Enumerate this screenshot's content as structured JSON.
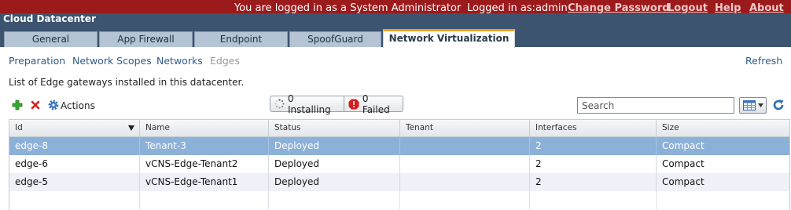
{
  "app": {
    "title": "Cloud Datacenter"
  },
  "topbar": {
    "logged_in_as_role": "You are logged in as a System Administrator",
    "logged_in_user": "Logged in as:admin",
    "links": [
      "Change Password",
      "Logout",
      "Help",
      "About"
    ]
  },
  "tabs": [
    {
      "label": "General",
      "active": false
    },
    {
      "label": "App Firewall",
      "active": false
    },
    {
      "label": "Endpoint",
      "active": false
    },
    {
      "label": "SpoofGuard",
      "active": false
    },
    {
      "label": "Network Virtualization",
      "active": true
    }
  ],
  "subnav": {
    "items": [
      {
        "label": "Preparation",
        "enabled": true
      },
      {
        "label": "Network Scopes",
        "enabled": true
      },
      {
        "label": "Networks",
        "enabled": true
      },
      {
        "label": "Edges",
        "enabled": false
      }
    ],
    "refresh": "Refresh"
  },
  "description": "List of Edge gateways installed in this datacenter.",
  "toolbar": {
    "add_icon": "plus-icon",
    "delete_icon": "x-icon",
    "actions_icon": "gear-icon",
    "actions_label": "Actions",
    "installing": "0 Installing",
    "failed": "0 Failed",
    "search_placeholder": "Search",
    "column_picker_icon": "grid-columns-icon",
    "refresh_icon": "refresh-icon"
  },
  "grid": {
    "columns": [
      "Id",
      "Name",
      "Status",
      "Tenant",
      "Interfaces",
      "Size"
    ],
    "sort_column": "Id",
    "rows": [
      {
        "id": "edge-8",
        "name": "Tenant-3",
        "status": "Deployed",
        "tenant": "",
        "interfaces": "2",
        "size": "Compact",
        "selected": true
      },
      {
        "id": "edge-6",
        "name": "vCNS-Edge-Tenant2",
        "status": "Deployed",
        "tenant": "",
        "interfaces": "2",
        "size": "Compact",
        "selected": false
      },
      {
        "id": "edge-5",
        "name": "vCNS-Edge-Tenant1",
        "status": "Deployed",
        "tenant": "",
        "interfaces": "2",
        "size": "Compact",
        "selected": false
      }
    ]
  },
  "colors": {
    "banner": "#9b1a1c",
    "tab_band": "#3c5470",
    "active_tab_accent": "#f0a01e",
    "selected_row": "#8cb1d9",
    "link": "#2e5d8c"
  }
}
